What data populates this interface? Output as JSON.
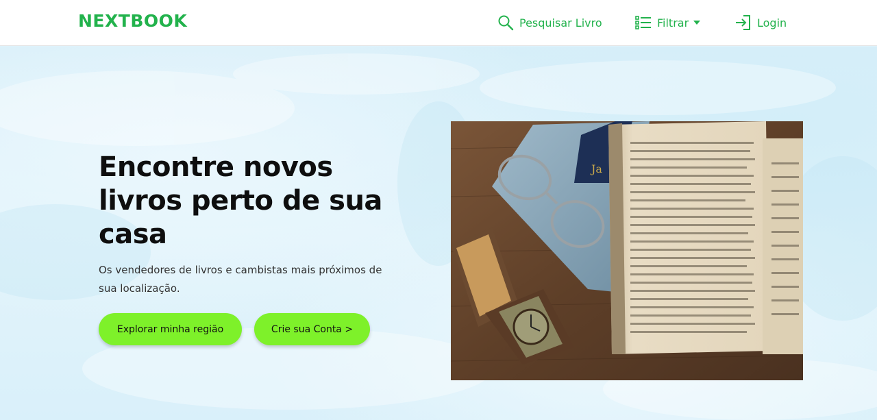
{
  "header": {
    "logo": "NEXTBOOK",
    "nav": {
      "search_label": "Pesquisar Livro",
      "filter_label": "Filtrar",
      "login_label": "Login"
    }
  },
  "hero": {
    "title": "Encontre novos livros perto de sua casa",
    "subtitle": "Os vendedores de livros e cambistas mais próximos de sua localização.",
    "buttons": {
      "explore_label": "Explorar minha região",
      "create_label": "Crie sua Conta >"
    }
  },
  "colors": {
    "brand_green": "#22b24c",
    "cta_green": "#7ef12a",
    "hero_background": "#dff2fb"
  },
  "icons": {
    "search": "search-icon",
    "filter": "list-icon",
    "filter_caret": "caret-down-icon",
    "login": "login-icon"
  }
}
